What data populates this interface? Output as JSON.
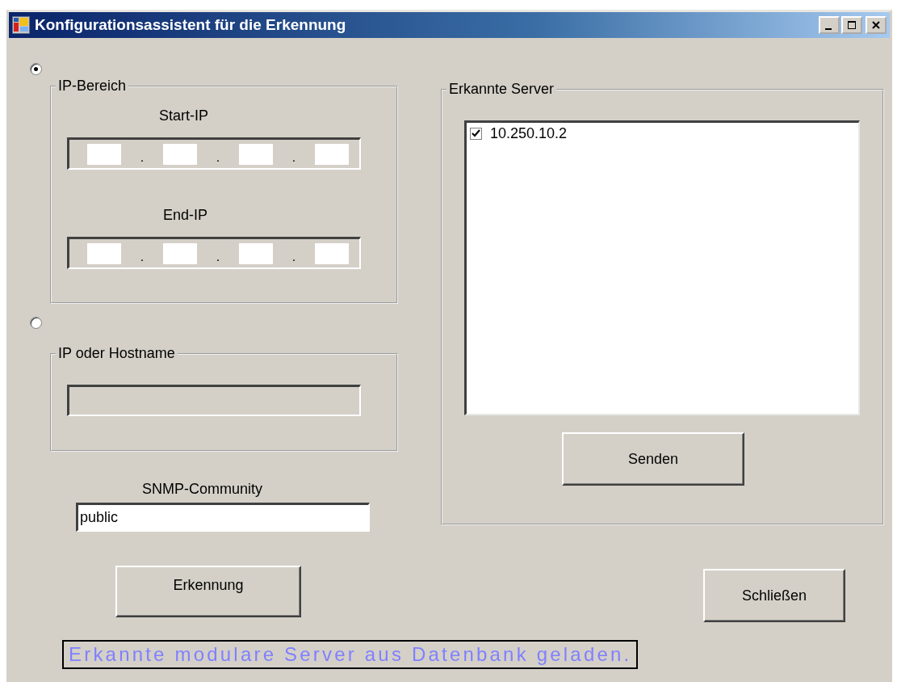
{
  "window": {
    "title": "Konfigurationsassistent für die Erkennung"
  },
  "ip_range": {
    "selected": true,
    "title": "IP-Bereich",
    "start_label": "Start-IP",
    "end_label": "End-IP",
    "octet_separator": "."
  },
  "host": {
    "selected": false,
    "title": "IP oder Hostname"
  },
  "community": {
    "label": "SNMP-Community",
    "value": "public"
  },
  "detect_button": "Erkennung",
  "servers": {
    "title": "Erkannte Server",
    "items": [
      {
        "label": "10.250.10.2",
        "checked": true
      }
    ],
    "send_button": "Senden"
  },
  "close_button": "Schließen",
  "status": "Erkannte modulare Server aus Datenbank geladen."
}
